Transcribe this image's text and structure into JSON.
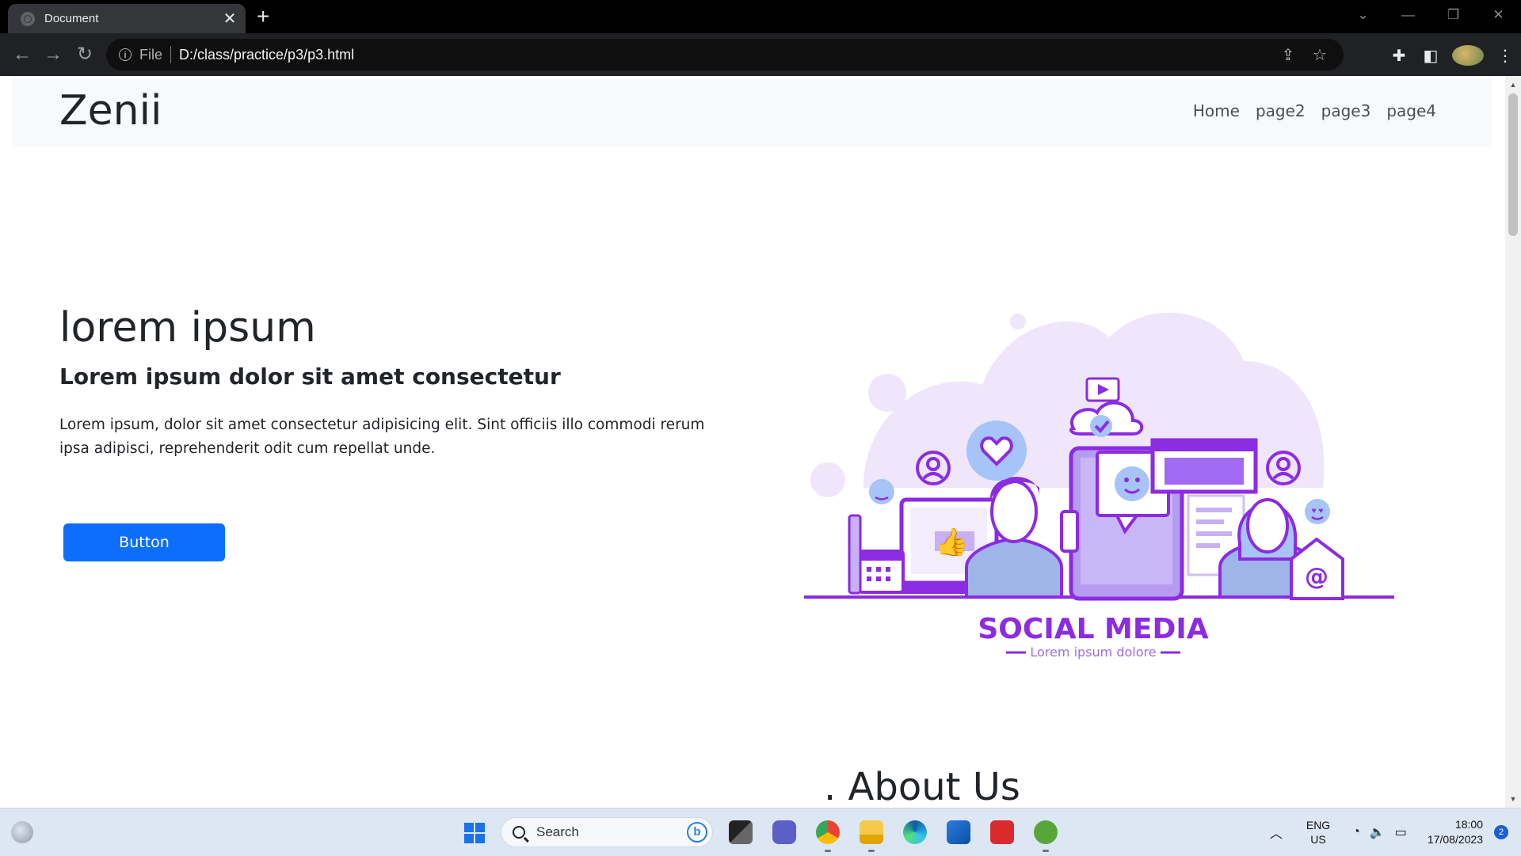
{
  "browser": {
    "tab_title": "Document",
    "new_tab": "+",
    "scheme_label": "File",
    "url": "D:/class/practice/p3/p3.html"
  },
  "site": {
    "brand": "Zenii",
    "nav": [
      "Home",
      "page2",
      "page3",
      "page4"
    ]
  },
  "hero": {
    "title": "lorem ipsum",
    "subtitle": "Lorem ipsum dolor sit amet consectetur",
    "text": "Lorem ipsum, dolor sit amet consectetur adipisicing elit. Sint officiis illo commodi rerum ipsa adipisci, reprehenderit odit cum repellat unde.",
    "button": "Button"
  },
  "illustration": {
    "title": "SOCIAL MEDIA",
    "caption": "Lorem ipsum dolore",
    "accent": "#8b2be2",
    "light": "#d9c6f5"
  },
  "about": {
    "heading": ". About Us"
  },
  "taskbar": {
    "search_label": "Search",
    "lang_top": "ENG",
    "lang_bottom": "US",
    "time": "18:00",
    "date": "17/08/2023",
    "notification_count": "2",
    "apps": [
      "start-icon",
      "search-icon",
      "task-view-icon",
      "teams-icon",
      "chrome-icon",
      "file-explorer-icon",
      "edge-icon",
      "store-icon",
      "gift-icon",
      "utorrent-icon"
    ]
  }
}
